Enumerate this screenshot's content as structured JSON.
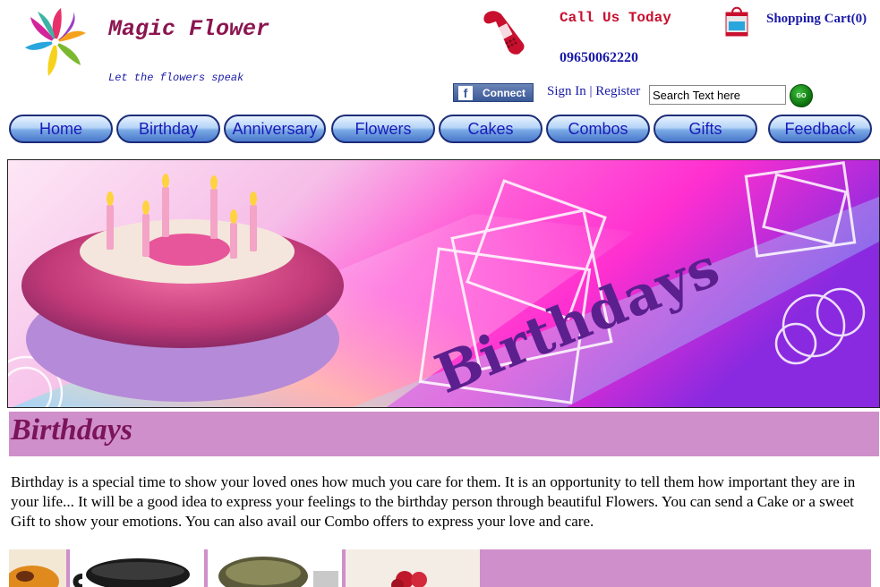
{
  "header": {
    "site_name": "Magic Flower",
    "tagline": "Let the flowers speak",
    "call_label": "Call Us Today",
    "phone_number": "09650062220",
    "cart_label": "Shopping Cart(0)",
    "logo_icon": "pinwheel-flower-logo",
    "phone_icon": "mobile-phone-icon",
    "cart_icon": "shopping-bag-icon"
  },
  "auth": {
    "facebook_connect": "Connect",
    "sign_in": "Sign In",
    "separator": "|",
    "register": "Register"
  },
  "search": {
    "value": "Search Text here",
    "go_label": "GO"
  },
  "nav": [
    "Home",
    "Birthday",
    "Anniversary",
    "Flowers",
    "Cakes",
    "Combos",
    "Gifts",
    "Feedback"
  ],
  "banner": {
    "text": "Birthdays"
  },
  "section": {
    "title": "Birthdays",
    "description": "Birthday is a special time to show your loved ones how much you care for them. It is an opportunity to tell them how important they are in your life... It will be a good idea to express your feelings to the birthday person through beautiful Flowers. You can send a Cake or a sweet Gift to show your emotions. You can also avail our Combo offers to express your love and care."
  },
  "colors": {
    "brand": "#8b1550",
    "link": "#1a1aa8",
    "call": "#c8102e",
    "section_bg": "#cf8fcb",
    "section_title": "#7b1458"
  }
}
